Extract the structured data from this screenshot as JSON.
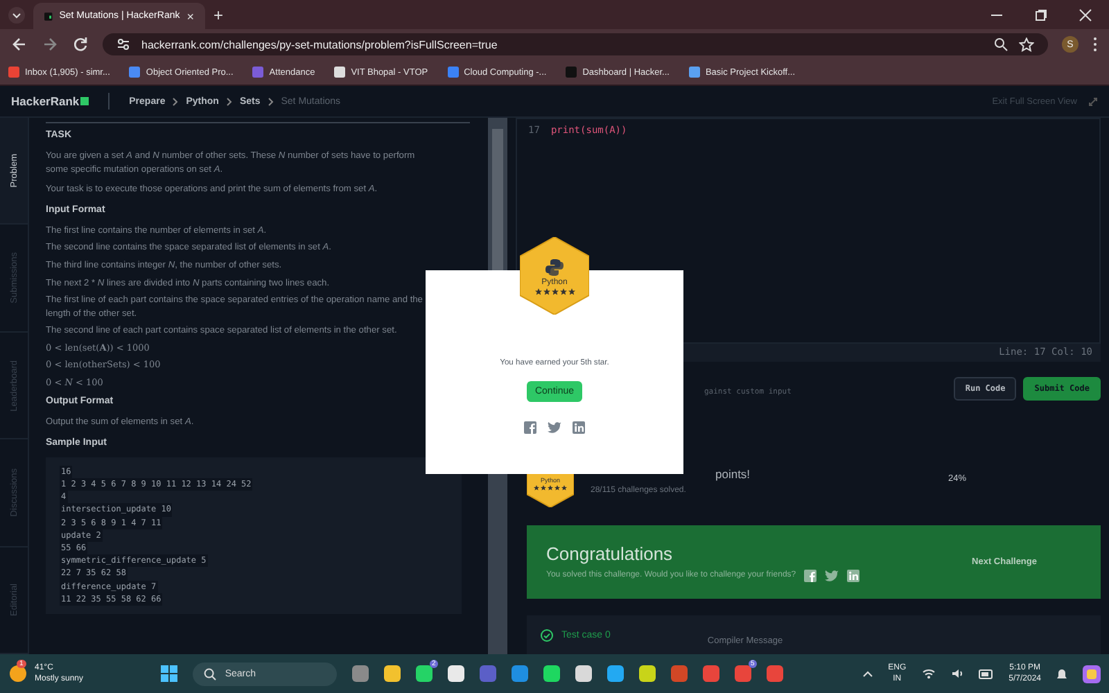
{
  "browser": {
    "tab": {
      "title": "Set Mutations | HackerRank",
      "close": "×",
      "selected": true
    },
    "new_tab": "+",
    "url": "hackerrank.com/challenges/py-set-mutations/problem?isFullScreen=true",
    "profile": "S",
    "bookmarks": [
      {
        "label": "Inbox (1,905) - simr...",
        "color": "#ea4335"
      },
      {
        "label": "Object Oriented Pro...",
        "color": "#4a8af4"
      },
      {
        "label": "Attendance",
        "color": "#7b5cd6"
      },
      {
        "label": "VIT Bhopal - VTOP",
        "color": "#dddddd"
      },
      {
        "label": "Cloud Computing -...",
        "color": "#3b82f6"
      },
      {
        "label": "Dashboard | Hacker...",
        "color": "#111111"
      },
      {
        "label": "Basic Project Kickoff...",
        "color": "#5aa0f0"
      }
    ]
  },
  "header": {
    "logo": "HackerRank",
    "breadcrumb": [
      "Prepare",
      "Python",
      "Sets",
      "Set Mutations"
    ],
    "exit": "Exit Full Screen View"
  },
  "side_tabs": [
    {
      "label": "Problem",
      "selected": true
    },
    {
      "label": "Submissions",
      "selected": false
    },
    {
      "label": "Leaderboard",
      "selected": false
    },
    {
      "label": "Discussions",
      "selected": false
    },
    {
      "label": "Editorial",
      "selected": false
    }
  ],
  "problem": [
    {
      "kind": "heading",
      "text": "TASK"
    },
    {
      "kind": "para",
      "text": "You are given a set *A* and *N* number of other sets. These *N* number of sets have to perform some specific mutation operations on set *A*."
    },
    {
      "kind": "para",
      "text": "Your task is to execute those operations and print the sum of elements from set *A*."
    },
    {
      "kind": "heading",
      "text": "Input Format"
    },
    {
      "kind": "line",
      "text": "The first line contains the number of elements in set *A*."
    },
    {
      "kind": "line",
      "text": "The second line contains the space separated list of elements in set *A*."
    },
    {
      "kind": "line",
      "text": "The third line contains integer *N*, the number of other sets."
    },
    {
      "kind": "line",
      "text": "The next 2 * *N* lines are divided into *N* parts containing two lines each."
    },
    {
      "kind": "line",
      "text": "The first line of each part contains the space separated entries of the operation name and the length of the other set."
    },
    {
      "kind": "line",
      "text": "The second line of each part contains space separated list of elements in the other set."
    },
    {
      "kind": "math",
      "text": "0 < len(set(**A**)) < 1000"
    },
    {
      "kind": "math",
      "text": "0 < len(otherSets) < 100"
    },
    {
      "kind": "math",
      "text": "0 < *N* < 100"
    },
    {
      "kind": "heading",
      "text": "Output Format"
    },
    {
      "kind": "para",
      "text": "Output the sum of elements in set *A*."
    },
    {
      "kind": "heading",
      "text": "Sample Input"
    },
    {
      "kind": "code",
      "lines": [
        "16",
        "1 2 3 4 5 6 7 8 9 10 11 12 13 14 24 52",
        "4",
        "intersection_update 10",
        "2 3 5 6 8 9 1 4 7 11",
        "update 2",
        "55 66",
        "symmetric_difference_update 5",
        "22 7 35 62 58",
        "difference_update 7",
        "11 22 35 55 58 62 66"
      ]
    }
  ],
  "editor": {
    "line_number": "17",
    "code": "print(sum(A))",
    "status": "Line: 17 Col: 10"
  },
  "actions": {
    "custom_input": "gainst custom input",
    "buttons": [
      {
        "label": "Run Code",
        "kind": "secondary"
      },
      {
        "label": "Submit Code",
        "kind": "primary"
      }
    ]
  },
  "result": {
    "badge": {
      "label": "Python",
      "stars": 5
    },
    "points": "points!",
    "solved": "28/115 challenges solved.",
    "progress": "24%"
  },
  "congrats": {
    "title": "Congratulations",
    "text": "You solved this challenge. Would you like to challenge your friends?",
    "next": "Next Challenge"
  },
  "tests": {
    "case": "Test case 0",
    "passed": true,
    "message_label": "Compiler Message"
  },
  "modal": {
    "badge": {
      "label": "Python",
      "stars": 5
    },
    "message": "You have earned your 5th star.",
    "button": "Continue"
  },
  "taskbar": {
    "weather": {
      "badge": "1",
      "temp": "41°C",
      "desc": "Mostly sunny"
    },
    "search": "Search",
    "apps": [
      {
        "color": "#8a8a8a"
      },
      {
        "color": "#f2c12e"
      },
      {
        "color": "#25d366",
        "badge": "2"
      },
      {
        "color": "#e9e9e9"
      },
      {
        "color": "#5b5fc7"
      },
      {
        "color": "#1f8ee0"
      },
      {
        "color": "#1ed760"
      },
      {
        "color": "#d9d9d9"
      },
      {
        "color": "#23a9f2"
      },
      {
        "color": "#c8d419"
      },
      {
        "color": "#d24726"
      },
      {
        "color": "#e8453c"
      },
      {
        "color": "#e8453c",
        "badge": "5"
      },
      {
        "color": "#e8453c"
      }
    ],
    "lang": "ENG",
    "region": "IN",
    "time": "5:10 PM",
    "date": "5/7/2024"
  }
}
